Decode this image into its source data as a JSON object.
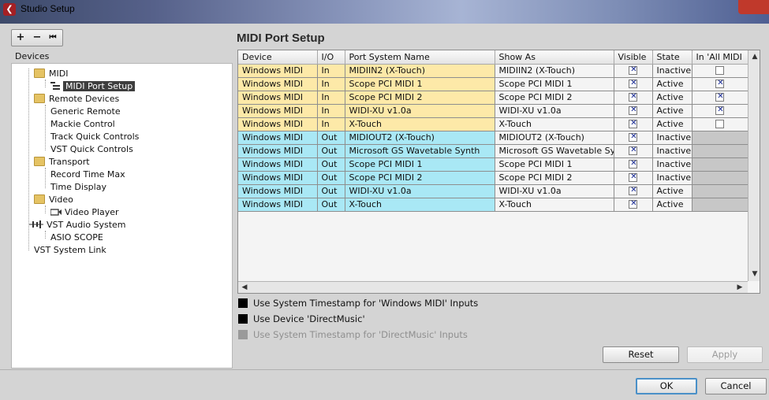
{
  "window": {
    "title": "Studio Setup"
  },
  "toolbar": {
    "add_glyph": "+",
    "remove_glyph": "−",
    "reset_glyph": "⏮"
  },
  "sidebar": {
    "header": "Devices",
    "items": [
      {
        "label": "MIDI"
      },
      {
        "label": "MIDI Port Setup"
      },
      {
        "label": "Remote Devices"
      },
      {
        "label": "Generic Remote"
      },
      {
        "label": "Mackie Control"
      },
      {
        "label": "Track Quick Controls"
      },
      {
        "label": "VST Quick Controls"
      },
      {
        "label": "Transport"
      },
      {
        "label": "Record Time Max"
      },
      {
        "label": "Time Display"
      },
      {
        "label": "Video"
      },
      {
        "label": "Video Player"
      },
      {
        "label": "VST Audio System"
      },
      {
        "label": "ASIO SCOPE"
      },
      {
        "label": "VST System Link"
      }
    ]
  },
  "panel": {
    "title": "MIDI Port Setup"
  },
  "table": {
    "headers": [
      "Device",
      "I/O",
      "Port System Name",
      "Show As",
      "Visible",
      "State",
      "In 'All MIDI"
    ],
    "rows": [
      {
        "device": "Windows MIDI",
        "io": "In",
        "port": "MIDIIN2 (X-Touch)",
        "show_as": "MIDIIN2 (X-Touch)",
        "visible": true,
        "state": "Inactive",
        "all_midi": false
      },
      {
        "device": "Windows MIDI",
        "io": "In",
        "port": "Scope PCI MIDI 1",
        "show_as": "Scope PCI MIDI 1",
        "visible": true,
        "state": "Active",
        "all_midi": true
      },
      {
        "device": "Windows MIDI",
        "io": "In",
        "port": "Scope PCI MIDI 2",
        "show_as": "Scope PCI MIDI 2",
        "visible": true,
        "state": "Active",
        "all_midi": true
      },
      {
        "device": "Windows MIDI",
        "io": "In",
        "port": "WIDI-XU v1.0a",
        "show_as": "WIDI-XU v1.0a",
        "visible": true,
        "state": "Active",
        "all_midi": true
      },
      {
        "device": "Windows MIDI",
        "io": "In",
        "port": "X-Touch",
        "show_as": "X-Touch",
        "visible": true,
        "state": "Active",
        "all_midi": false
      },
      {
        "device": "Windows MIDI",
        "io": "Out",
        "port": "MIDIOUT2 (X-Touch)",
        "show_as": "MIDIOUT2 (X-Touch)",
        "visible": true,
        "state": "Inactive",
        "all_midi": null
      },
      {
        "device": "Windows MIDI",
        "io": "Out",
        "port": "Microsoft GS Wavetable Synth",
        "show_as": "Microsoft GS Wavetable Synth",
        "visible": true,
        "state": "Inactive",
        "all_midi": null
      },
      {
        "device": "Windows MIDI",
        "io": "Out",
        "port": "Scope PCI MIDI 1",
        "show_as": "Scope PCI MIDI 1",
        "visible": true,
        "state": "Inactive",
        "all_midi": null
      },
      {
        "device": "Windows MIDI",
        "io": "Out",
        "port": "Scope PCI MIDI 2",
        "show_as": "Scope PCI MIDI 2",
        "visible": true,
        "state": "Inactive",
        "all_midi": null
      },
      {
        "device": "Windows MIDI",
        "io": "Out",
        "port": "WIDI-XU v1.0a",
        "show_as": "WIDI-XU v1.0a",
        "visible": true,
        "state": "Active",
        "all_midi": null
      },
      {
        "device": "Windows MIDI",
        "io": "Out",
        "port": "X-Touch",
        "show_as": "X-Touch",
        "visible": true,
        "state": "Active",
        "all_midi": null
      }
    ],
    "colors": {
      "in_row": "#fde9a8",
      "out_row": "#a9e8f5",
      "check": "#10228f"
    }
  },
  "options": {
    "timestamp_windows": "Use System Timestamp for 'Windows MIDI' Inputs",
    "use_directmusic": "Use Device 'DirectMusic'",
    "timestamp_directmusic": "Use System Timestamp for 'DirectMusic' Inputs"
  },
  "buttons": {
    "reset": "Reset",
    "apply": "Apply",
    "ok": "OK",
    "cancel": "Cancel"
  },
  "icons": {
    "app": "cubase-logo-icon",
    "folder": "folder-icon",
    "midi_port": "midi-port-icon",
    "video": "video-player-icon",
    "audio": "vst-audio-icon"
  }
}
